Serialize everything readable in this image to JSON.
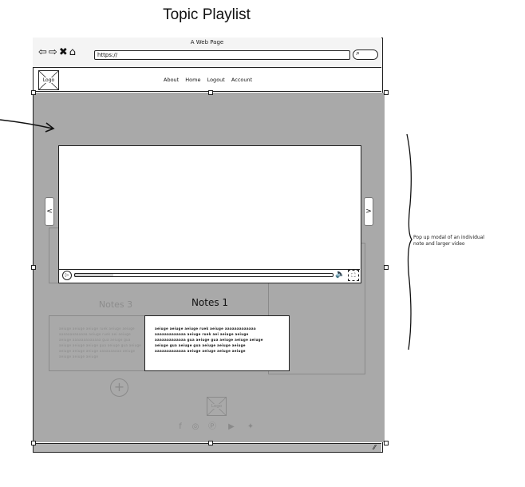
{
  "page_title": "Topic Playlist",
  "browser": {
    "title": "A Web Page",
    "url": "https://",
    "nav_icons": [
      "back-arrow-icon",
      "forward-arrow-icon",
      "close-icon",
      "home-icon"
    ],
    "search_icon": "search-icon"
  },
  "site_header": {
    "logo": "Logo",
    "nav": [
      "About",
      "Home",
      "Logout",
      "Account"
    ]
  },
  "background_page": {
    "notes_left_title": "Notes 3",
    "notes_center_title": "Notes 1",
    "notes_left_text": "aeiuge aeiuge aeiuge ruek aeiuge aeiuge aaaaaaaaaaaaa aeiuge ruek aei aeiuge aeiuge aaaaaaaaaaaaa gua aeiuge gua aeiuge aeiuge aeiuge gua aeiuge gua aeiuge aeiuge aeiuge aeiuge aaaaaaaaaa aeiuge aeiuge aeiuge aeiuge",
    "notes_center_text": "aeiuge aeiuge aeiuge ruek aeiuge aaaaaaaaaaaaa aaaaaaaaaaaaa aeiuge ruek aei aeiuge aeiuge aaaaaaaaaaaaa gua aeiuge gua aeiuge aeiuge aeiuge aeiuge gua aeiuge gua aeiuge aeiuge aeiuge aaaaaaaaaaaaa aeiuge aeiuge aeiuge aeiuge",
    "footer_logo": "Logo",
    "social_icons": [
      "facebook-icon",
      "instagram-icon",
      "pinterest-icon",
      "youtube-icon",
      "twitter-icon"
    ],
    "add_icon": "plus-circle-icon"
  },
  "modal": {
    "prev_label": "<",
    "next_label": ">",
    "progress": 0.15
  },
  "annotation": "Pop up modal of an individual note and larger video"
}
